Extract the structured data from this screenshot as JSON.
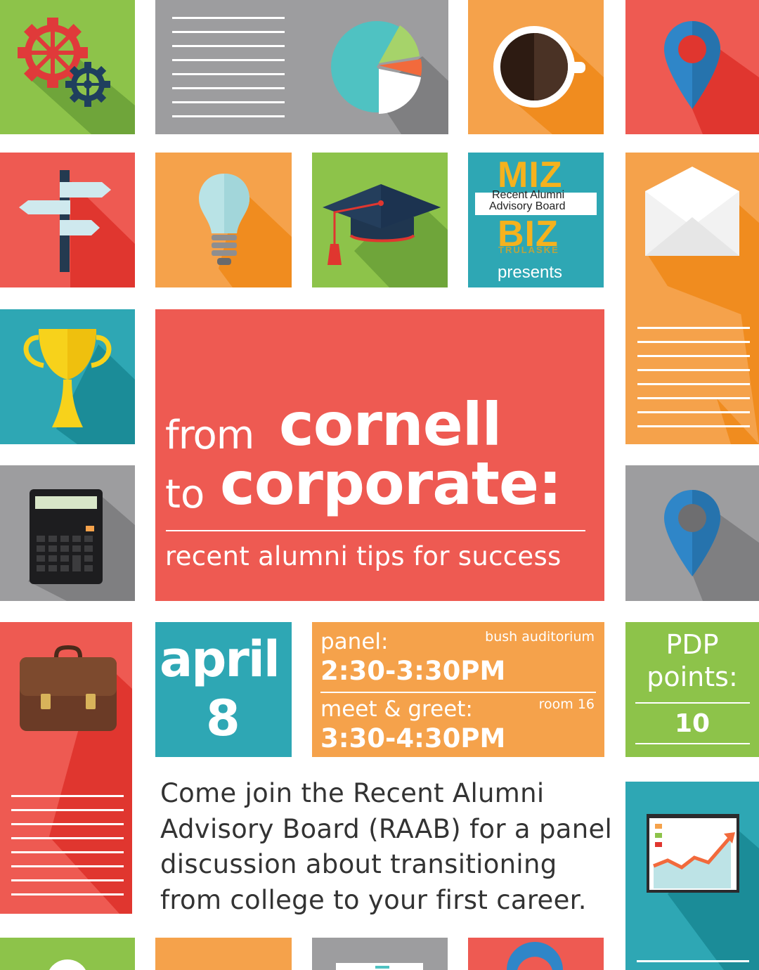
{
  "logo": {
    "line1": "MIZ",
    "band_line1": "Recent Alumni",
    "band_line2": "Advisory Board",
    "line2": "BIZ",
    "small": "TRULASKE",
    "presents": "presents"
  },
  "title": {
    "word1": "from",
    "word2": "cornell",
    "word3": "to",
    "word4": "corporate:",
    "subtitle": "recent alumni tips for success"
  },
  "date": {
    "month": "april",
    "day": "8"
  },
  "schedule": {
    "panel_label": "panel:",
    "panel_location": "bush auditorium",
    "panel_time": "2:30-3:30PM",
    "meet_label": "meet & greet:",
    "meet_location": "room 16",
    "meet_time": "3:30-4:30PM"
  },
  "pdp": {
    "label_line1": "PDP",
    "label_line2": "points:",
    "value": "10"
  },
  "description": {
    "line1": "Come join the Recent Alumni",
    "line2": "Advisory Board (RAAB) for a panel",
    "line3": "discussion about transitioning",
    "line4": "from college to your first career."
  },
  "icons": [
    "gears-icon",
    "document-lines-icon",
    "pie-chart-icon",
    "coffee-cup-icon",
    "map-pin-icon",
    "signpost-icon",
    "lightbulb-icon",
    "graduation-cap-icon",
    "envelope-icon",
    "trophy-icon",
    "calculator-icon",
    "briefcase-icon",
    "presentation-chart-icon"
  ],
  "colors": {
    "green": "#8dc34a",
    "gray": "#9d9d9f",
    "orange": "#f5a24b",
    "red": "#ee5a52",
    "teal": "#2ea7b4",
    "text_dark": "#333333"
  }
}
